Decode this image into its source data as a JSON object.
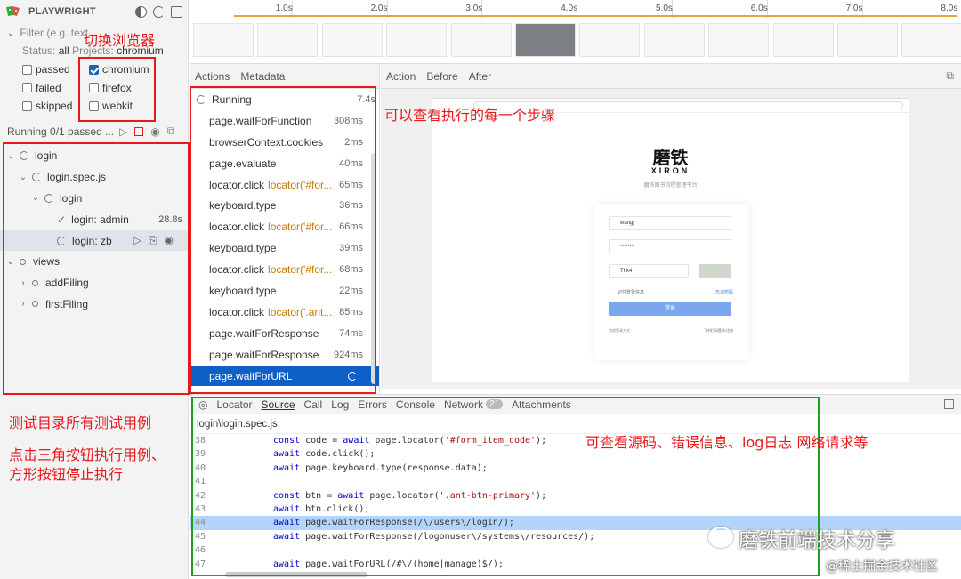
{
  "sidebar": {
    "title": "PLAYWRIGHT",
    "filter_placeholder": "Filter (e.g. text",
    "status_label": "Status:",
    "status_value": "all",
    "projects_label": "Projects:",
    "projects_value": "chromium",
    "status_options": [
      "passed",
      "failed",
      "skipped"
    ],
    "browsers": [
      {
        "label": "chromium",
        "checked": true
      },
      {
        "label": "firefox",
        "checked": false
      },
      {
        "label": "webkit",
        "checked": false
      }
    ],
    "running_text": "Running 0/1 passed ...",
    "tree": [
      {
        "label": "login",
        "level": 0,
        "type": "spin"
      },
      {
        "label": "login.spec.js",
        "level": 1,
        "type": "spin"
      },
      {
        "label": "login",
        "level": 2,
        "type": "spin"
      },
      {
        "label": "login: admin",
        "level": 3,
        "type": "pass",
        "duration": "28.8s"
      },
      {
        "label": "login: zb",
        "level": 3,
        "type": "spin",
        "selected": true
      },
      {
        "label": "views",
        "level": 0,
        "type": "dot"
      },
      {
        "label": "addFiling",
        "level": 1,
        "type": "dot"
      },
      {
        "label": "firstFiling",
        "level": 1,
        "type": "dot"
      }
    ]
  },
  "timeline": {
    "ticks": [
      "1.0s",
      "2.0s",
      "3.0s",
      "4.0s",
      "5.0s",
      "6.0s",
      "7.0s",
      "8.0s"
    ]
  },
  "actions_panel": {
    "tabs": [
      "Actions",
      "Metadata"
    ],
    "running_label": "Running",
    "running_time": "7.4s",
    "items": [
      {
        "name": "page.waitForFunction",
        "sel": "",
        "time": "308ms"
      },
      {
        "name": "browserContext.cookies",
        "sel": "",
        "time": "2ms"
      },
      {
        "name": "page.evaluate",
        "sel": "",
        "time": "40ms"
      },
      {
        "name": "locator.click",
        "sel": "locator('#for...",
        "time": "65ms"
      },
      {
        "name": "keyboard.type",
        "sel": "",
        "time": "36ms"
      },
      {
        "name": "locator.click",
        "sel": "locator('#for...",
        "time": "66ms"
      },
      {
        "name": "keyboard.type",
        "sel": "",
        "time": "39ms"
      },
      {
        "name": "locator.click",
        "sel": "locator('#for...",
        "time": "68ms"
      },
      {
        "name": "keyboard.type",
        "sel": "",
        "time": "22ms"
      },
      {
        "name": "locator.click",
        "sel": "locator('.ant...",
        "time": "85ms"
      },
      {
        "name": "page.waitForResponse",
        "sel": "",
        "time": "74ms"
      },
      {
        "name": "page.waitForResponse",
        "sel": "",
        "time": "924ms"
      },
      {
        "name": "page.waitForURL",
        "sel": "",
        "time": "",
        "active": true
      }
    ]
  },
  "snapshot_panel": {
    "tabs": [
      "Action",
      "Before",
      "After"
    ],
    "brand_cn": "磨铁",
    "brand_en": "XIRON",
    "subtitle": "磨铁图书流程管理平台",
    "username": "wangj",
    "password": "••••••••",
    "code_value": "Thk4",
    "remember": "记住登录信息",
    "forgot": "忘记密码",
    "login_button": "登录",
    "other_login": "其他登录方式：",
    "register": "飞书扫码登录/注册"
  },
  "bottom_panel": {
    "tabs": [
      "Locator",
      "Source",
      "Call",
      "Log",
      "Errors",
      "Console",
      "Network",
      "Attachments"
    ],
    "network_count": "21",
    "file_path": "login\\login.spec.js",
    "code": [
      {
        "ln": "38",
        "text": "const code = await page.locator('#form_item_code');"
      },
      {
        "ln": "39",
        "text": "await code.click();"
      },
      {
        "ln": "40",
        "text": "await page.keyboard.type(response.data);"
      },
      {
        "ln": "41",
        "text": ""
      },
      {
        "ln": "42",
        "text": "const btn = await page.locator('.ant-btn-primary');"
      },
      {
        "ln": "43",
        "text": "await btn.click();"
      },
      {
        "ln": "44",
        "text": "await page.waitForResponse(/\\/users\\/login/);",
        "hl": true
      },
      {
        "ln": "45",
        "text": "await page.waitForResponse(/logonuser\\/systems\\/resources/);"
      },
      {
        "ln": "46",
        "text": ""
      },
      {
        "ln": "47",
        "text": "await page.waitForURL(/#\\/(home|manage)$/);"
      }
    ]
  },
  "annotations": {
    "switch_browser": "切换浏览器",
    "view_steps": "可以查看执行的每一个步骤",
    "test_dir": "测试目录所有测试用例",
    "click_triangle": "点击三角按钮执行用例、",
    "square_stop": "方形按钮停止执行",
    "view_source": "可查看源码、错误信息、log日志   网络请求等",
    "watermark_main": "磨铁前端技术分享",
    "watermark_sub": "@稀土掘金技术社区"
  },
  "colors": {
    "accent": "#0e5fc7",
    "annotation_red": "#e8191c",
    "annotation_green": "#1ea01e"
  }
}
